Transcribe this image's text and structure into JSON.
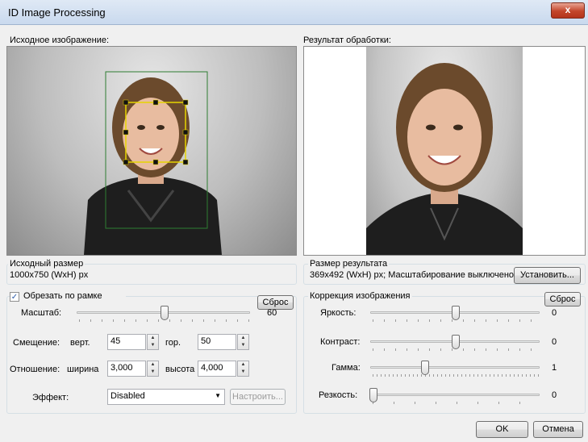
{
  "window": {
    "title": "ID Image Processing",
    "close_glyph": "x"
  },
  "source": {
    "label": "Исходное изображение:",
    "size_group": "Исходный размер",
    "size_value": "1000x750 (WxH) px"
  },
  "result": {
    "label": "Результат обработки:",
    "size_group": "Размер результата",
    "size_value": "369x492 (WxH) px; Масштабирование выключено",
    "set_button": "Установить..."
  },
  "crop": {
    "checkbox_label": "Обрезать по рамке",
    "checked": true,
    "check_glyph": "✓",
    "reset_button": "Сброс",
    "scale_label": "Масштаб:",
    "scale_value": "60",
    "offset_label": "Смещение:",
    "vert_label": "верт.",
    "vert_value": "45",
    "hor_label": "гор.",
    "hor_value": "50",
    "ratio_label": "Отношение:",
    "width_label": "ширина",
    "width_value": "3,000",
    "height_label": "высота",
    "height_value": "4,000",
    "effect_label": "Эффект:",
    "effect_value": "Disabled",
    "configure_button": "Настроить..."
  },
  "correction": {
    "group_title": "Коррекция изображения",
    "reset_button": "Сброс",
    "brightness_label": "Яркость:",
    "brightness_value": "0",
    "contrast_label": "Контраст:",
    "contrast_value": "0",
    "gamma_label": "Гамма:",
    "gamma_value": "1",
    "sharpness_label": "Резкость:",
    "sharpness_value": "0"
  },
  "footer": {
    "ok_button": "OK",
    "cancel_button": "Отмена"
  },
  "spin_glyphs": {
    "up": "▲",
    "down": "▼",
    "dropdown": "▼"
  },
  "colors": {
    "crop_frame": "#e6d400",
    "face_frame": "#2e7d32"
  }
}
